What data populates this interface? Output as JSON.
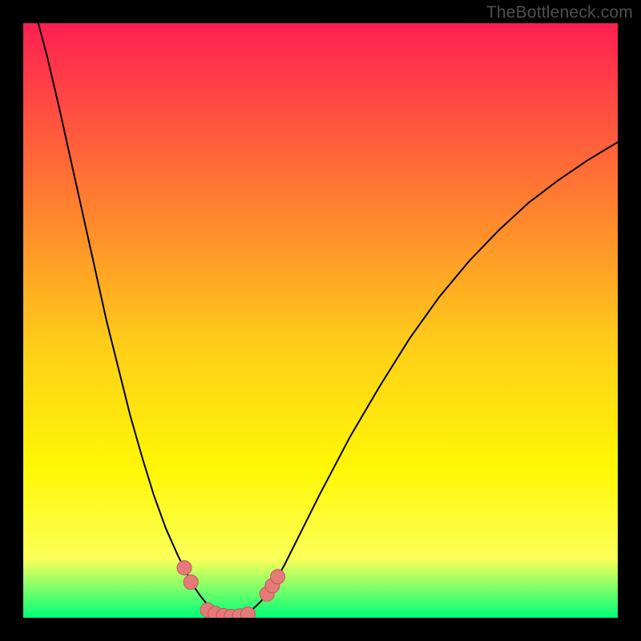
{
  "watermark": "TheBottleneck.com",
  "colors": {
    "gradient_top": "#ff1f52",
    "gradient_mid1": "#ff7e30",
    "gradient_mid2": "#ffd018",
    "gradient_mid3": "#fff705",
    "gradient_mid4": "#fcff58",
    "gradient_bottom": "#00ff7a",
    "curve": "#000000",
    "marker_fill": "#e77a78",
    "marker_stroke": "#b85a58",
    "frame": "#000000"
  },
  "chart_data": {
    "type": "line",
    "title": "",
    "xlabel": "",
    "ylabel": "",
    "xlim": [
      0,
      100
    ],
    "ylim": [
      0,
      100
    ],
    "left_curve": [
      {
        "x": 0.0,
        "y": 108.0
      },
      {
        "x": 2.0,
        "y": 102.0
      },
      {
        "x": 4.0,
        "y": 94.5
      },
      {
        "x": 6.0,
        "y": 86.0
      },
      {
        "x": 8.0,
        "y": 77.0
      },
      {
        "x": 10.0,
        "y": 68.0
      },
      {
        "x": 12.0,
        "y": 59.0
      },
      {
        "x": 14.0,
        "y": 50.0
      },
      {
        "x": 16.0,
        "y": 42.0
      },
      {
        "x": 18.0,
        "y": 34.0
      },
      {
        "x": 20.0,
        "y": 27.0
      },
      {
        "x": 22.0,
        "y": 20.5
      },
      {
        "x": 24.0,
        "y": 15.0
      },
      {
        "x": 26.0,
        "y": 10.5
      },
      {
        "x": 27.0,
        "y": 8.5
      },
      {
        "x": 28.0,
        "y": 6.5
      },
      {
        "x": 29.0,
        "y": 4.8
      },
      {
        "x": 30.0,
        "y": 3.4
      },
      {
        "x": 31.0,
        "y": 2.2
      },
      {
        "x": 32.0,
        "y": 1.2
      },
      {
        "x": 33.0,
        "y": 0.6
      },
      {
        "x": 34.0,
        "y": 0.2
      },
      {
        "x": 35.0,
        "y": 0.0
      }
    ],
    "right_curve": [
      {
        "x": 35.0,
        "y": 0.0
      },
      {
        "x": 36.0,
        "y": 0.2
      },
      {
        "x": 37.0,
        "y": 0.5
      },
      {
        "x": 38.0,
        "y": 1.0
      },
      {
        "x": 39.0,
        "y": 1.8
      },
      {
        "x": 40.0,
        "y": 2.8
      },
      {
        "x": 41.0,
        "y": 4.0
      },
      {
        "x": 42.0,
        "y": 5.5
      },
      {
        "x": 43.0,
        "y": 7.2
      },
      {
        "x": 44.0,
        "y": 9.0
      },
      {
        "x": 46.0,
        "y": 13.0
      },
      {
        "x": 48.0,
        "y": 17.0
      },
      {
        "x": 50.0,
        "y": 21.0
      },
      {
        "x": 55.0,
        "y": 30.5
      },
      {
        "x": 60.0,
        "y": 39.0
      },
      {
        "x": 65.0,
        "y": 47.0
      },
      {
        "x": 70.0,
        "y": 54.0
      },
      {
        "x": 75.0,
        "y": 60.0
      },
      {
        "x": 80.0,
        "y": 65.2
      },
      {
        "x": 85.0,
        "y": 69.8
      },
      {
        "x": 90.0,
        "y": 73.6
      },
      {
        "x": 95.0,
        "y": 77.0
      },
      {
        "x": 100.0,
        "y": 80.0
      }
    ],
    "markers": [
      {
        "x": 27.1,
        "y": 8.4
      },
      {
        "x": 28.2,
        "y": 6.0
      },
      {
        "x": 31.0,
        "y": 1.3
      },
      {
        "x": 32.3,
        "y": 0.7
      },
      {
        "x": 33.7,
        "y": 0.35
      },
      {
        "x": 35.0,
        "y": 0.2
      },
      {
        "x": 36.4,
        "y": 0.3
      },
      {
        "x": 37.8,
        "y": 0.6
      },
      {
        "x": 41.0,
        "y": 4.0
      },
      {
        "x": 41.9,
        "y": 5.4
      },
      {
        "x": 42.8,
        "y": 6.9
      }
    ]
  }
}
